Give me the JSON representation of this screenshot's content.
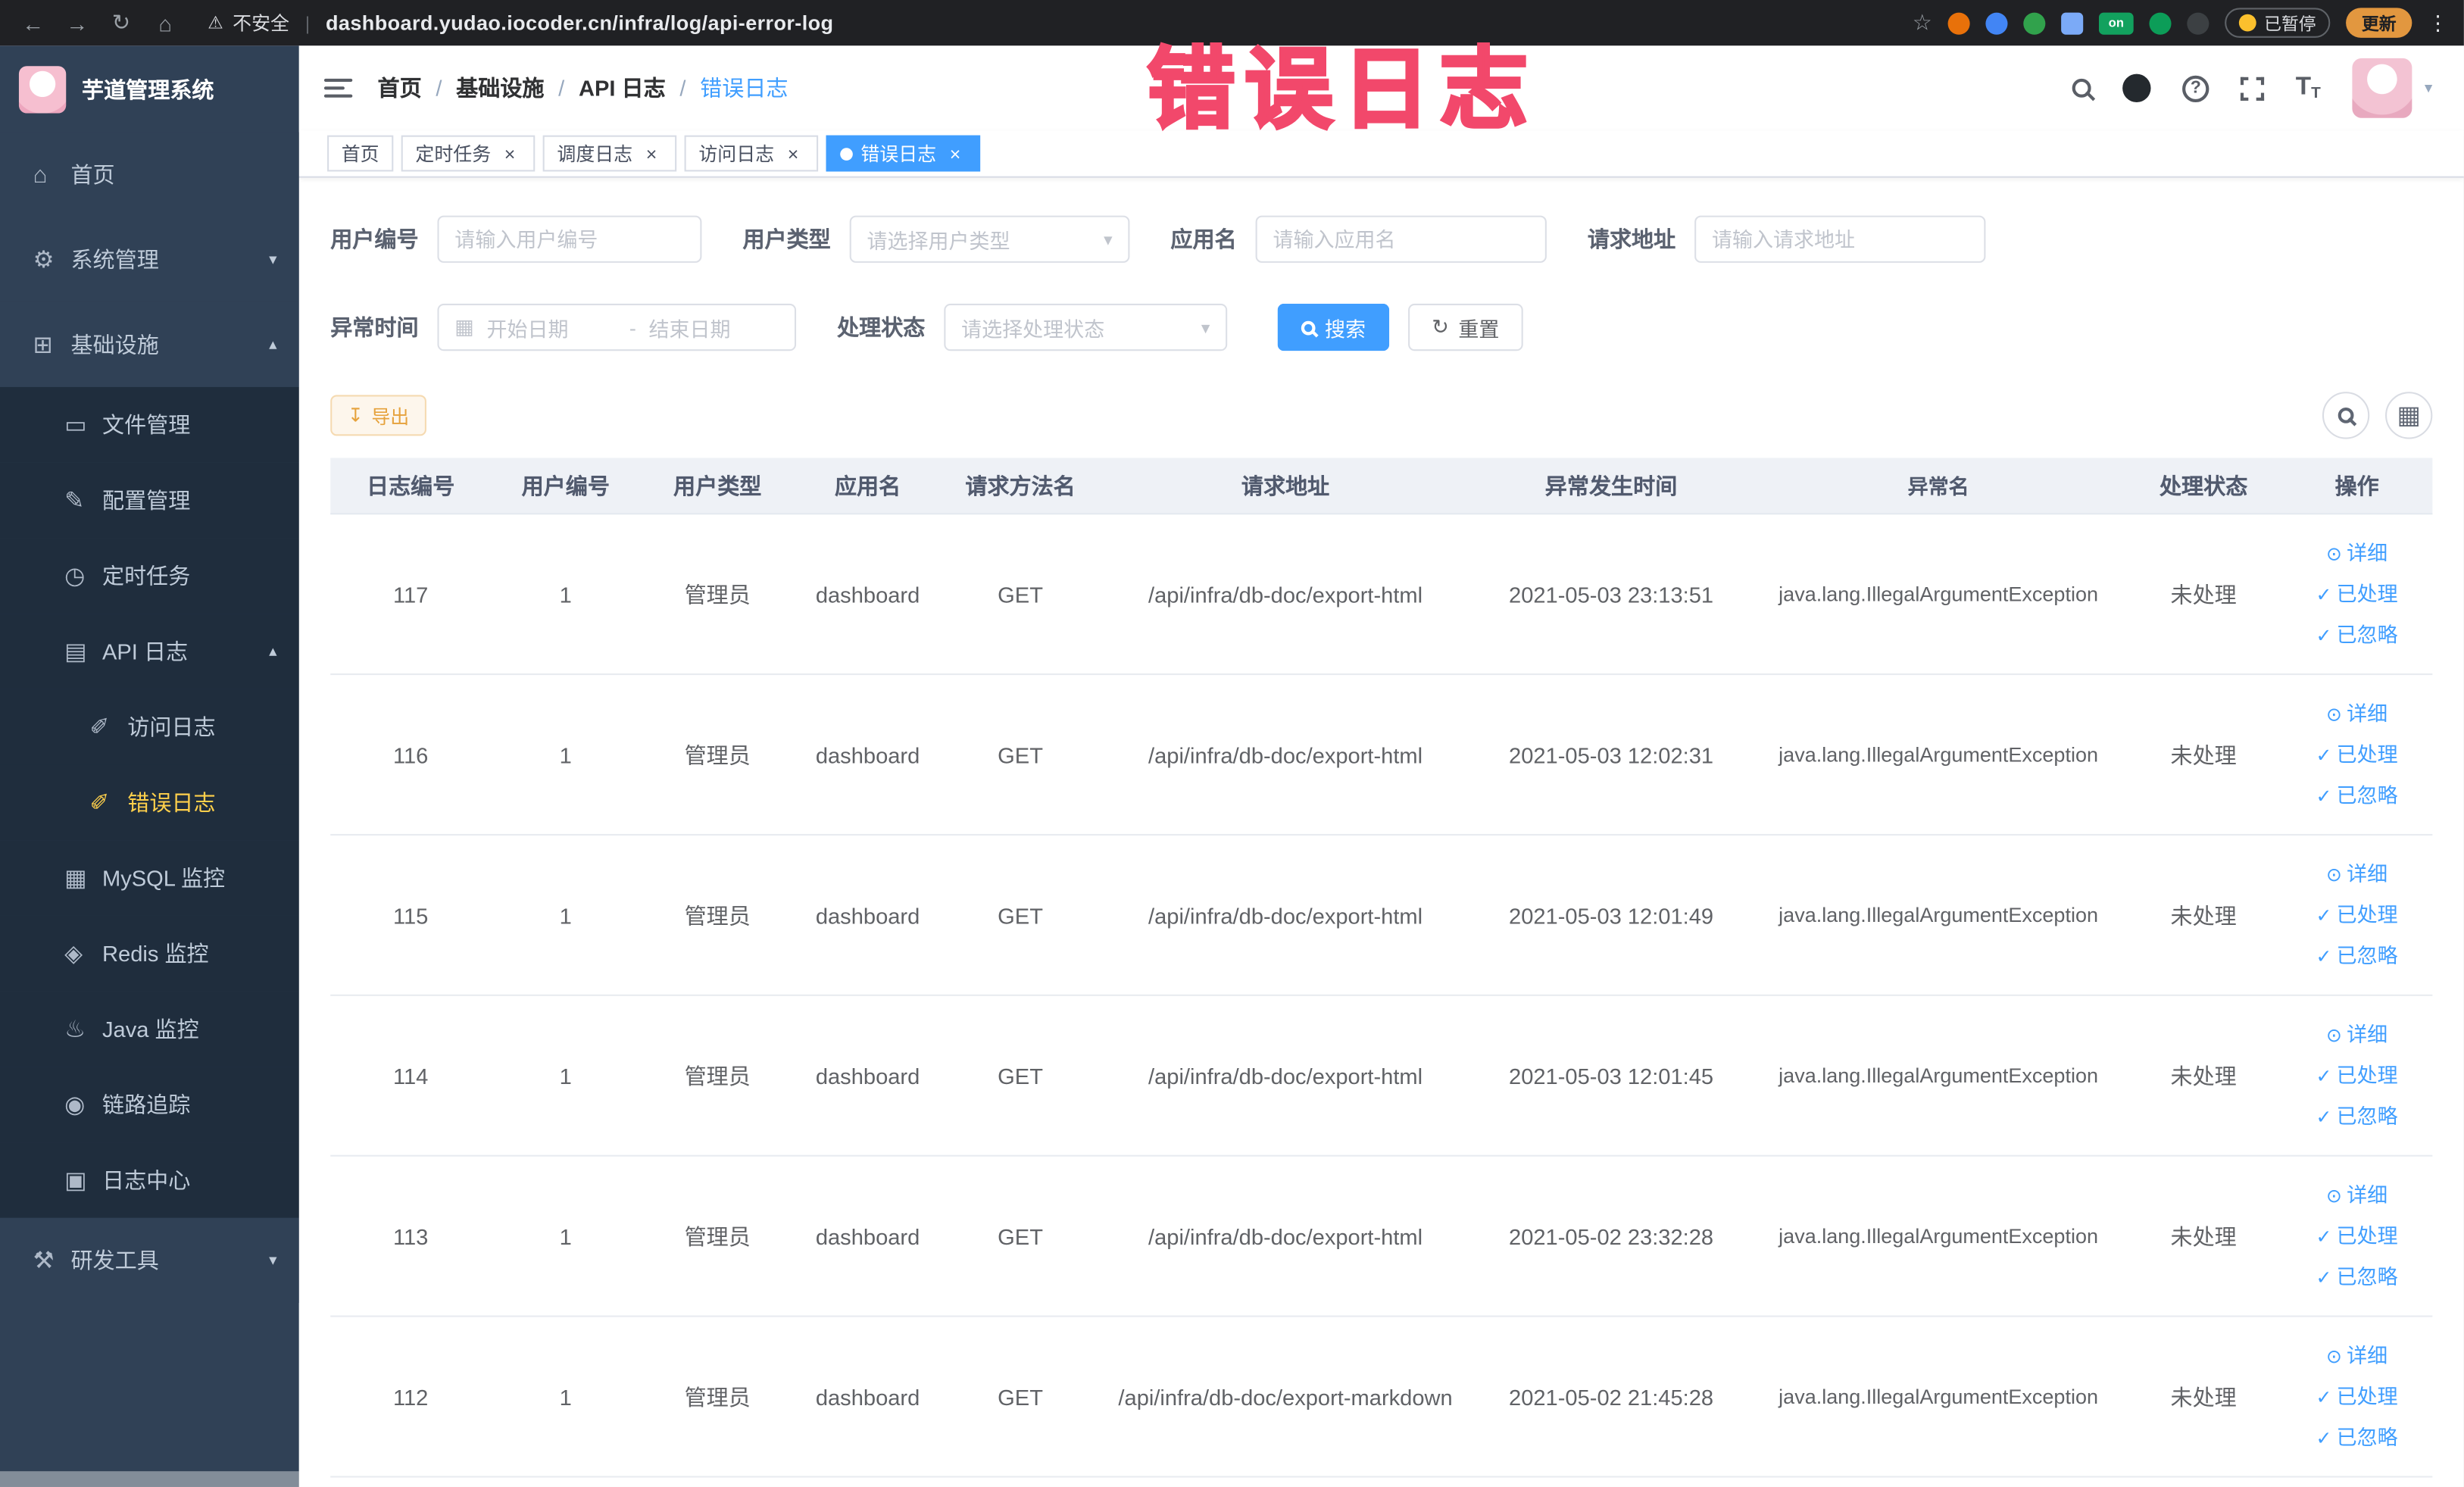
{
  "browser": {
    "security_label": "不安全",
    "url": "dashboard.yudao.iocoder.cn/infra/log/api-error-log",
    "on_badge": "on",
    "paused_badge": "已暂停",
    "update_button": "更新"
  },
  "annotation": {
    "text": "错误日志",
    "color": "#f2486b"
  },
  "sidebar": {
    "logo_title": "芋道管理系统",
    "items": [
      {
        "key": "home",
        "label": "首页",
        "icon": "home-icon",
        "level": 1
      },
      {
        "key": "system",
        "label": "系统管理",
        "icon": "gear-icon",
        "level": 1,
        "arrow": "down"
      },
      {
        "key": "infra",
        "label": "基础设施",
        "icon": "grid-icon",
        "level": 1,
        "arrow": "up"
      },
      {
        "key": "file",
        "label": "文件管理",
        "icon": "file-icon",
        "level": 2
      },
      {
        "key": "config",
        "label": "配置管理",
        "icon": "config-icon",
        "level": 2
      },
      {
        "key": "job",
        "label": "定时任务",
        "icon": "timer-icon",
        "level": 2
      },
      {
        "key": "api-log",
        "label": "API 日志",
        "icon": "log-icon",
        "level": 2,
        "arrow": "up"
      },
      {
        "key": "access-log",
        "label": "访问日志",
        "icon": "doc-icon",
        "level": 3
      },
      {
        "key": "error-log",
        "label": "错误日志",
        "icon": "doc-icon",
        "level": 3,
        "active": true
      },
      {
        "key": "mysql",
        "label": "MySQL 监控",
        "icon": "mysql-icon",
        "level": 2
      },
      {
        "key": "redis",
        "label": "Redis 监控",
        "icon": "redis-icon",
        "level": 2
      },
      {
        "key": "java",
        "label": "Java 监控",
        "icon": "java-icon",
        "level": 2
      },
      {
        "key": "tracer",
        "label": "链路追踪",
        "icon": "trace-icon",
        "level": 2
      },
      {
        "key": "log-center",
        "label": "日志中心",
        "icon": "log-center-icon",
        "level": 2
      },
      {
        "key": "dev-tools",
        "label": "研发工具",
        "icon": "tools-icon",
        "level": 1,
        "arrow": "down"
      }
    ]
  },
  "header": {
    "breadcrumb": [
      "首页",
      "基础设施",
      "API 日志",
      "错误日志"
    ]
  },
  "tags_view": [
    {
      "key": "home",
      "label": "首页",
      "closable": false,
      "active": false
    },
    {
      "key": "job",
      "label": "定时任务",
      "closable": true,
      "active": false
    },
    {
      "key": "job-log",
      "label": "调度日志",
      "closable": true,
      "active": false
    },
    {
      "key": "access-log",
      "label": "访问日志",
      "closable": true,
      "active": false
    },
    {
      "key": "error-log",
      "label": "错误日志",
      "closable": true,
      "active": true
    }
  ],
  "filters": {
    "user_id": {
      "label": "用户编号",
      "placeholder": "请输入用户编号",
      "value": ""
    },
    "user_type": {
      "label": "用户类型",
      "placeholder": "请选择用户类型"
    },
    "app_name": {
      "label": "应用名",
      "placeholder": "请输入应用名",
      "value": ""
    },
    "request_url": {
      "label": "请求地址",
      "placeholder": "请输入请求地址",
      "value": ""
    },
    "exception_time": {
      "label": "异常时间",
      "start_placeholder": "开始日期",
      "separator": "-",
      "end_placeholder": "结束日期"
    },
    "process_status": {
      "label": "处理状态",
      "placeholder": "请选择处理状态"
    },
    "search_label": "搜索",
    "reset_label": "重置"
  },
  "toolbar": {
    "export_label": "导出"
  },
  "table": {
    "headers": [
      "日志编号",
      "用户编号",
      "用户类型",
      "应用名",
      "请求方法名",
      "请求地址",
      "异常发生时间",
      "异常名",
      "处理状态",
      "操作"
    ],
    "actions": [
      {
        "key": "detail",
        "label": "详细",
        "icon": "view-icon"
      },
      {
        "key": "processed",
        "label": "已处理",
        "icon": "check-icon"
      },
      {
        "key": "ignored",
        "label": "已忽略",
        "icon": "check-icon"
      }
    ],
    "rows": [
      {
        "id": "117",
        "user_id": "1",
        "user_type": "管理员",
        "app": "dashboard",
        "method": "GET",
        "url": "/api/infra/db-doc/export-html",
        "time": "2021-05-03 23:13:51",
        "exception": "java.lang.IllegalArgumentException",
        "status": "未处理"
      },
      {
        "id": "116",
        "user_id": "1",
        "user_type": "管理员",
        "app": "dashboard",
        "method": "GET",
        "url": "/api/infra/db-doc/export-html",
        "time": "2021-05-03 12:02:31",
        "exception": "java.lang.IllegalArgumentException",
        "status": "未处理"
      },
      {
        "id": "115",
        "user_id": "1",
        "user_type": "管理员",
        "app": "dashboard",
        "method": "GET",
        "url": "/api/infra/db-doc/export-html",
        "time": "2021-05-03 12:01:49",
        "exception": "java.lang.IllegalArgumentException",
        "status": "未处理"
      },
      {
        "id": "114",
        "user_id": "1",
        "user_type": "管理员",
        "app": "dashboard",
        "method": "GET",
        "url": "/api/infra/db-doc/export-html",
        "time": "2021-05-03 12:01:45",
        "exception": "java.lang.IllegalArgumentException",
        "status": "未处理"
      },
      {
        "id": "113",
        "user_id": "1",
        "user_type": "管理员",
        "app": "dashboard",
        "method": "GET",
        "url": "/api/infra/db-doc/export-html",
        "time": "2021-05-02 23:32:28",
        "exception": "java.lang.IllegalArgumentException",
        "status": "未处理"
      },
      {
        "id": "112",
        "user_id": "1",
        "user_type": "管理员",
        "app": "dashboard",
        "method": "GET",
        "url": "/api/infra/db-doc/export-markdown",
        "time": "2021-05-02 21:45:28",
        "exception": "java.lang.IllegalArgumentException",
        "status": "未处理"
      }
    ]
  },
  "colors": {
    "accent": "#409eff",
    "sidebar_bg": "#304156",
    "submenu_bg": "#1f2d3d",
    "menu_active": "#ffd04b",
    "annotation": "#f2486b",
    "export_button_text": "#e6a23c",
    "table_header_bg": "#eef1f6"
  }
}
